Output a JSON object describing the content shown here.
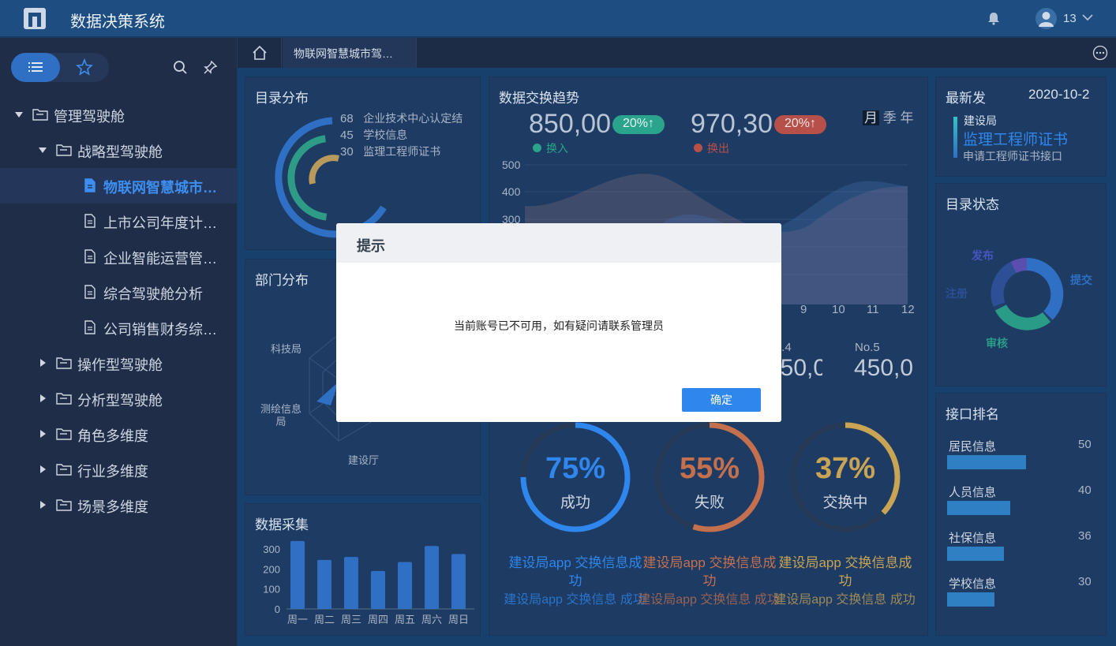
{
  "app": {
    "title": "数据决策系统",
    "user": "13"
  },
  "sidebar": {
    "items": [
      {
        "label": "管理驾驶舱",
        "level": 0,
        "type": "folder",
        "expanded": true
      },
      {
        "label": "战略型驾驶舱",
        "level": 1,
        "type": "folder",
        "expanded": true
      },
      {
        "label": "物联网智慧城市…",
        "level": 2,
        "type": "file",
        "active": true
      },
      {
        "label": "上市公司年度计…",
        "level": 2,
        "type": "file"
      },
      {
        "label": "企业智能运营管…",
        "level": 2,
        "type": "file"
      },
      {
        "label": "综合驾驶舱分析",
        "level": 2,
        "type": "file"
      },
      {
        "label": "公司销售财务综…",
        "level": 2,
        "type": "file"
      },
      {
        "label": "操作型驾驶舱",
        "level": 1,
        "type": "folder",
        "expanded": false
      },
      {
        "label": "分析型驾驶舱",
        "level": 1,
        "type": "folder",
        "expanded": false
      },
      {
        "label": "角色多维度",
        "level": 1,
        "type": "folder",
        "expanded": false
      },
      {
        "label": "行业多维度",
        "level": 1,
        "type": "folder",
        "expanded": false
      },
      {
        "label": "场景多维度",
        "level": 1,
        "type": "folder",
        "expanded": false
      }
    ]
  },
  "tabs": {
    "active": "物联网智慧城市驾…"
  },
  "dashboard": {
    "catalog": {
      "title": "目录分布",
      "items": [
        {
          "value": "68",
          "label": "企业技术中心认定结"
        },
        {
          "value": "45",
          "label": "学校信息"
        },
        {
          "value": "30",
          "label": "监理工程师证书"
        }
      ]
    },
    "trend": {
      "title": "数据交换趋势",
      "in_value": "850,00",
      "in_badge": "20%↑",
      "in_label": "换入",
      "out_value": "970,30",
      "out_badge": "20%↑",
      "out_label": "换出",
      "periods": [
        "月",
        "季",
        "年"
      ],
      "y_ticks": [
        "500",
        "400",
        "300"
      ],
      "x_ticks": [
        "9",
        "10",
        "11",
        "12"
      ]
    },
    "latest": {
      "title": "最新发",
      "date": "2020-10-2",
      "org": "建设局",
      "name": "监理工程师证书",
      "desc": "申请工程师证书接口"
    },
    "dept": {
      "title": "部门分布",
      "labels": [
        "科技局",
        "测绘信息局",
        "建设厅"
      ]
    },
    "status": {
      "title": "目录状态",
      "labels": [
        "发布",
        "提交",
        "注册",
        "审核"
      ]
    },
    "rank_tiles": [
      {
        "no": "No.4",
        "value": "450,0"
      },
      {
        "no": "No.5",
        "value": "450,0"
      }
    ],
    "rank": {
      "title": "接口排名",
      "items": [
        {
          "name": "居民信息",
          "value": "50",
          "fill": 0.5
        },
        {
          "name": "人员信息",
          "value": "40",
          "fill": 0.4
        },
        {
          "name": "社保信息",
          "value": "36",
          "fill": 0.36
        },
        {
          "name": "学校信息",
          "value": "30",
          "fill": 0.3
        }
      ]
    },
    "collect": {
      "title": "数据采集"
    },
    "gauges": [
      {
        "pct": "75%",
        "label": "成功",
        "caption": "建设局app 交换信息成功",
        "caption2": "建设局app 交换信息 成功",
        "color": "#2f86ec",
        "fill": 0.75
      },
      {
        "pct": "55%",
        "label": "失败",
        "caption": "建设局app 交换信息成功",
        "caption2": "建设局app 交换信息 成功",
        "color": "#c4704e",
        "fill": 0.55
      },
      {
        "pct": "37%",
        "label": "交换中",
        "caption": "建设局app 交换信息成功",
        "caption2": "建设局app 交换信息 成功",
        "color": "#c9a455",
        "fill": 0.37
      }
    ]
  },
  "chart_data": [
    {
      "type": "bar",
      "title": "数据采集",
      "categories": [
        "周一",
        "周二",
        "周三",
        "周四",
        "周五",
        "周六",
        "周日"
      ],
      "values": [
        340,
        245,
        260,
        190,
        235,
        315,
        275
      ],
      "ylim": [
        0,
        300
      ],
      "y_ticks": [
        "0",
        "100",
        "200",
        "300"
      ]
    }
  ],
  "dialog": {
    "title": "提示",
    "message": "当前账号已不可用，如有疑问请联系管理员",
    "ok_label": "确定"
  }
}
